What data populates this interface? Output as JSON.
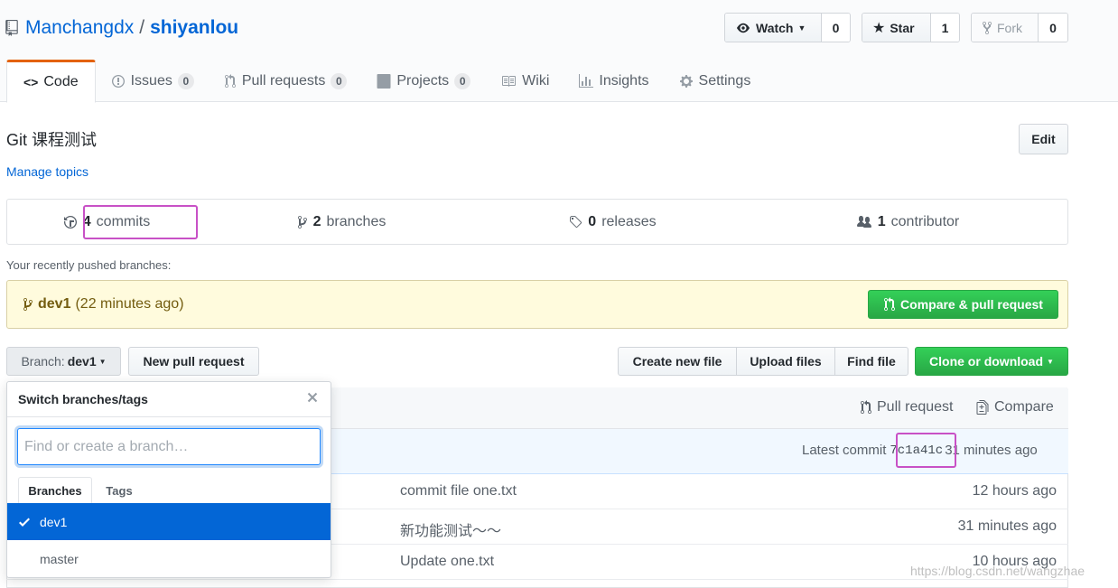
{
  "header": {
    "owner": "Manchangdx",
    "separator": "/",
    "repo": "shiyanlou",
    "watch_label": "Watch",
    "watch_count": "0",
    "star_label": "Star",
    "star_count": "1",
    "fork_label": "Fork",
    "fork_count": "0"
  },
  "tabs": [
    {
      "label": "Code",
      "icon": "code-icon",
      "selected": true
    },
    {
      "label": "Issues",
      "count": "0",
      "icon": "issue-icon"
    },
    {
      "label": "Pull requests",
      "count": "0",
      "icon": "git-pull-request-icon"
    },
    {
      "label": "Projects",
      "count": "0",
      "icon": "project-icon"
    },
    {
      "label": "Wiki",
      "icon": "book-icon"
    },
    {
      "label": "Insights",
      "icon": "graph-icon"
    },
    {
      "label": "Settings",
      "icon": "gear-icon"
    }
  ],
  "repo": {
    "description": "Git 课程测试",
    "manage_topics": "Manage topics",
    "edit_label": "Edit"
  },
  "summary": {
    "commits_num": "4",
    "commits_label": "commits",
    "branches_num": "2",
    "branches_label": "branches",
    "releases_num": "0",
    "releases_label": "releases",
    "contributors_num": "1",
    "contributors_label": "contributor"
  },
  "recent": {
    "label": "Your recently pushed branches:",
    "branch": "dev1",
    "time": "(22 minutes ago)",
    "compare_label": "Compare & pull request"
  },
  "toolbar": {
    "branch_prefix": "Branch:",
    "branch_name": "dev1",
    "new_pr": "New pull request",
    "create_file": "Create new file",
    "upload_files": "Upload files",
    "find_file": "Find file",
    "clone": "Clone or download"
  },
  "file_list": {
    "pull_request": "Pull request",
    "compare": "Compare",
    "latest_commit_label": "Latest commit",
    "latest_commit_sha": "7c1a41c",
    "latest_commit_time": "31 minutes ago",
    "rows": [
      {
        "message": "commit file one.txt",
        "age": "12 hours ago"
      },
      {
        "message": "新功能测试～～",
        "age": "31 minutes ago"
      },
      {
        "message": "Update one.txt",
        "age": "10 hours ago"
      }
    ]
  },
  "dropdown": {
    "title": "Switch branches/tags",
    "placeholder": "Find or create a branch…",
    "tab_branches": "Branches",
    "tab_tags": "Tags",
    "items": [
      {
        "name": "dev1",
        "selected": true
      },
      {
        "name": "master",
        "selected": false
      }
    ]
  },
  "watermark": "https://blog.csdn.net/wangzhae",
  "colors": {
    "link": "#0366d6",
    "selected_tab_border": "#e36209",
    "green_button": "#28a745",
    "highlight_annotation": "#c851c6",
    "recent_box_bg": "#fffbdd"
  }
}
